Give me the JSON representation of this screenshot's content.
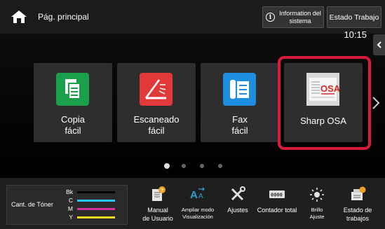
{
  "header": {
    "home_label": "Pág. principal",
    "info_label": "Information del sistema",
    "job_status_label": "Estado Trabajo"
  },
  "clock": "10:15",
  "tiles": [
    {
      "label": "Copia\nfácil",
      "icon": "copy-icon",
      "color": "#1aa04b"
    },
    {
      "label": "Escaneado\nfácil",
      "icon": "scan-icon",
      "color": "#e23a3a"
    },
    {
      "label": "Fax\nfácil",
      "icon": "fax-icon",
      "color": "#1e8fe0"
    },
    {
      "label": "Sharp OSA",
      "icon": "sharp-osa-icon",
      "color": "#cccccc"
    }
  ],
  "pager": {
    "count": 4,
    "active": 0
  },
  "toner": {
    "title": "Cant. de Tóner",
    "levels": [
      {
        "label": "Bk",
        "color": "#000000"
      },
      {
        "label": "C",
        "color": "#29c5f6"
      },
      {
        "label": "M",
        "color": "#d0329e"
      },
      {
        "label": "Y",
        "color": "#f4d61c"
      }
    ]
  },
  "functions": [
    {
      "label": "Manual\nde Usuario",
      "icon": "manual-icon"
    },
    {
      "label": "Ampliar modo\nVisualización",
      "icon": "text-size-icon"
    },
    {
      "label": "Ajustes",
      "icon": "settings-tools-icon"
    },
    {
      "label": "Contador total",
      "icon": "counter-icon"
    },
    {
      "label": "Brillo\nAjuste",
      "icon": "brightness-icon"
    },
    {
      "label": "Estado de\ntrabajos",
      "icon": "job-status-icon"
    }
  ]
}
